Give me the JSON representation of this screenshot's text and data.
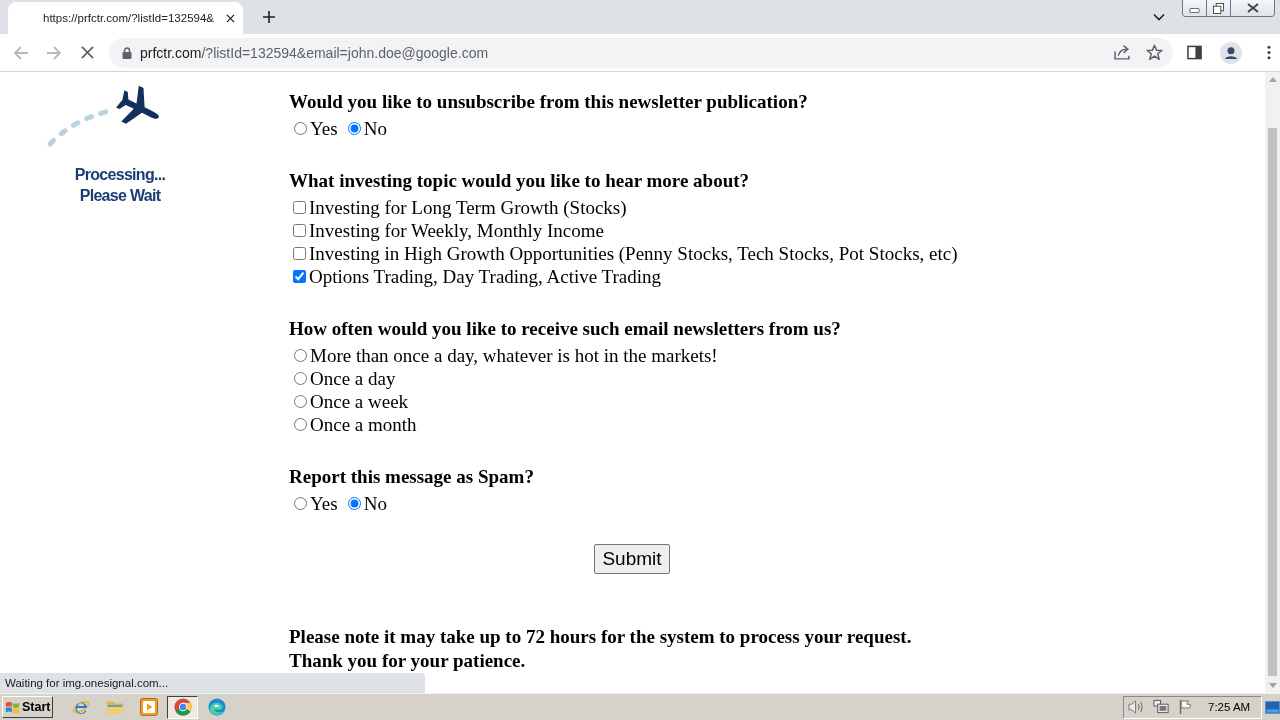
{
  "browser": {
    "tab": {
      "title": "https://prfctr.com/?listId=132594&"
    },
    "address_bar": {
      "host": "prfctr.com",
      "path": "/?listId=132594&email=john.doe@google.com"
    }
  },
  "page": {
    "logo": {
      "line_1": "Processing...",
      "line_2": "Please Wait"
    },
    "questions": [
      {
        "kind": "radio-inline",
        "question": "Would you like to unsubscribe from this newsletter publication?",
        "options": [
          {
            "label": "Yes",
            "selected": false
          },
          {
            "label": "No",
            "selected": true
          }
        ]
      },
      {
        "kind": "checkbox",
        "question": "What investing topic would you like to hear more about?",
        "options": [
          {
            "label": "Investing for Long Term Growth (Stocks)",
            "checked": false
          },
          {
            "label": "Investing for Weekly, Monthly Income",
            "checked": false
          },
          {
            "label": "Investing in High Growth Opportunities (Penny Stocks, Tech Stocks, Pot Stocks, etc)",
            "checked": false
          },
          {
            "label": "Options Trading, Day Trading, Active Trading",
            "checked": true
          }
        ]
      },
      {
        "kind": "radio",
        "question": "How often would you like to receive such email newsletters from us?",
        "options": [
          {
            "label": "More than once a day, whatever is hot in the markets!",
            "selected": false
          },
          {
            "label": "Once a day",
            "selected": false
          },
          {
            "label": "Once a week",
            "selected": false
          },
          {
            "label": "Once a month",
            "selected": false
          }
        ]
      },
      {
        "kind": "radio-inline",
        "question": "Report this message as Spam?",
        "options": [
          {
            "label": "Yes",
            "selected": false
          },
          {
            "label": "No",
            "selected": true
          }
        ]
      }
    ],
    "submit_button": "Submit",
    "note": [
      "Please note it may take up to 72 hours for the system to process your request.",
      "Thank you for your patience."
    ]
  },
  "status_bubble": "Waiting for img.onesignal.com...",
  "taskbar": {
    "start_button": "Start",
    "apps": [
      {
        "kind": "ie",
        "selected": false
      },
      {
        "kind": "folder",
        "selected": false
      },
      {
        "kind": "media-player",
        "selected": false
      },
      {
        "kind": "chrome",
        "selected": true
      },
      {
        "kind": "edge",
        "selected": false
      }
    ],
    "clock": "7:25 AM"
  }
}
